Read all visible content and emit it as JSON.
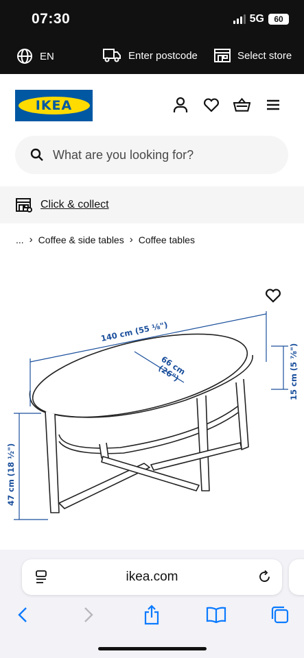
{
  "status_bar": {
    "time": "07:30",
    "network": "5G",
    "battery": "60"
  },
  "utility_bar": {
    "language": "EN",
    "postcode": "Enter postcode",
    "store": "Select store"
  },
  "header": {
    "logo_text": "IKEA"
  },
  "search": {
    "placeholder": "What are you looking for?"
  },
  "click_collect": {
    "label": "Click & collect"
  },
  "breadcrumb": {
    "ellipsis": "...",
    "items": [
      "Coffee & side tables",
      "Coffee tables"
    ]
  },
  "product_image": {
    "dim_length": "140 cm (55 ⅛\")",
    "dim_width_1": "66 cm",
    "dim_width_2": "(26\")",
    "dim_shelf": "15 cm (5 ⅞\")",
    "dim_height": "47 cm (18 ½\")"
  },
  "browser": {
    "url": "ikea.com"
  },
  "colors": {
    "brand_blue": "#0058a3",
    "brand_yellow": "#ffdb00",
    "dimension_blue": "#1a4f9c",
    "ios_blue": "#0a7aff"
  }
}
